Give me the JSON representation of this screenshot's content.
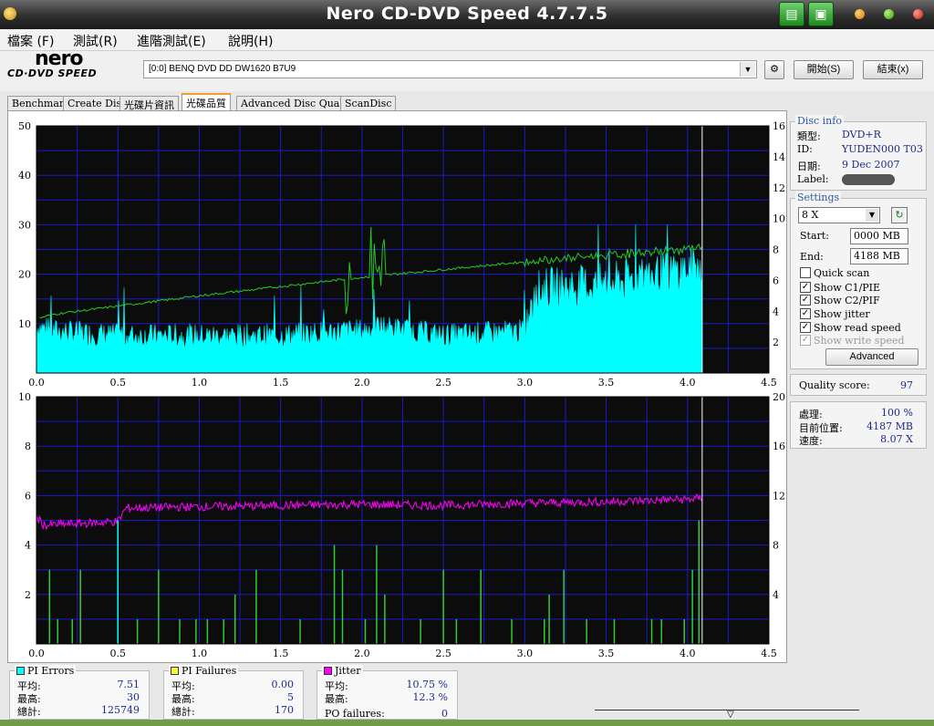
{
  "window": {
    "title": "Nero CD-DVD Speed 4.7.7.5"
  },
  "menu": [
    "檔案 (F)",
    "測試(R)",
    "進階測試(E)",
    "說明(H)"
  ],
  "logo": {
    "brand": "nero",
    "sub": "CD·DVD SPEED"
  },
  "toolbar": {
    "drive": "[0:0]   BENQ DVD DD DW1620 B7U9",
    "start_label": "開始(S)",
    "exit_label": "結束(x)"
  },
  "tabs": [
    "Benchmark",
    "Create Disc",
    "光碟片資訊",
    "光碟品質",
    "Advanced Disc Quality",
    "ScanDisc"
  ],
  "active_tab": "光碟品質",
  "disc_info": {
    "title": "Disc info",
    "type_label": "類型:",
    "type": "DVD+R",
    "id_label": "ID:",
    "id": "YUDEN000 T03",
    "date_label": "日期:",
    "date": "9 Dec 2007",
    "label_label": "Label:"
  },
  "settings": {
    "title": "Settings",
    "speed": "8 X",
    "start_label": "Start:",
    "start": "0000 MB",
    "end_label": "End:",
    "end": "4188 MB",
    "checkboxes": [
      {
        "label": "Quick scan",
        "checked": false
      },
      {
        "label": "Show C1/PIE",
        "checked": true
      },
      {
        "label": "Show C2/PIF",
        "checked": true
      },
      {
        "label": "Show jitter",
        "checked": true
      },
      {
        "label": "Show read speed",
        "checked": true
      },
      {
        "label": "Show write speed",
        "checked": true
      }
    ],
    "advanced_label": "Advanced"
  },
  "quality": {
    "label": "Quality score:",
    "value": "97"
  },
  "progress": {
    "process_label": "處理:",
    "process": "100 %",
    "position_label": "目前位置:",
    "position": "4187 MB",
    "speed_label": "速度:",
    "speed": "8.07 X"
  },
  "stats": {
    "pi_errors": {
      "title": "PI Errors",
      "avg_label": "平均:",
      "avg": "7.51",
      "max_label": "最高:",
      "max": "30",
      "total_label": "總計:",
      "total": "125749"
    },
    "pi_failures": {
      "title": "PI Failures",
      "avg_label": "平均:",
      "avg": "0.00",
      "max_label": "最高:",
      "max": "5",
      "total_label": "總計:",
      "total": "170"
    },
    "jitter": {
      "title": "Jitter",
      "avg_label": "平均:",
      "avg": "10.75 %",
      "max_label": "最高:",
      "max": "12.3 %",
      "po_label": "PO failures:",
      "po": "0"
    }
  },
  "colors": {
    "pie": "#00ffff",
    "pif": "#33cc33",
    "jitter": "#ff00ff",
    "speed": "#22cc22",
    "grid": "#1a1acc",
    "plot_bg": "#0c0c0c"
  },
  "chart_data": [
    {
      "type": "area",
      "x_ticks": [
        "0.0",
        "0.5",
        "1.0",
        "1.5",
        "2.0",
        "2.5",
        "3.0",
        "3.5",
        "4.0",
        "4.5"
      ],
      "y_ticks_left": [
        "10",
        "20",
        "30",
        "40",
        "50"
      ],
      "y_ticks_right": [
        "2",
        "4",
        "6",
        "8",
        "10",
        "12",
        "14",
        "16"
      ],
      "xlim": [
        0,
        4.5
      ],
      "ylim": [
        0,
        50
      ],
      "y2lim": [
        0,
        16
      ],
      "series": [
        {
          "values_at": [
            0,
            0.1,
            0.5,
            1.0,
            1.5,
            1.9,
            2.0,
            2.1,
            2.5,
            3.0,
            3.1,
            3.5,
            4.0,
            4.09
          ],
          "values": [
            9,
            8,
            7,
            7,
            7,
            8,
            8,
            9,
            7,
            8,
            16,
            17,
            20,
            21
          ]
        },
        {
          "values_at": [
            0,
            0.1,
            1.0,
            2.0,
            3.0,
            4.09
          ],
          "values": [
            3.5,
            3.8,
            5.0,
            6.2,
            7.2,
            8.1
          ]
        }
      ]
    },
    {
      "type": "bar",
      "x_ticks": [
        "0.0",
        "0.5",
        "1.0",
        "1.5",
        "2.0",
        "2.5",
        "3.0",
        "3.5",
        "4.0",
        "4.5"
      ],
      "y_ticks_left": [
        "2",
        "4",
        "6",
        "8",
        "10"
      ],
      "y_ticks_right": [
        "4",
        "8",
        "12",
        "16",
        "20"
      ],
      "xlim": [
        0,
        4.5
      ],
      "ylim": [
        0,
        10
      ],
      "y2lim": [
        0,
        20
      ],
      "pif_x": [
        0.08,
        0.13,
        0.22,
        0.27,
        0.5,
        0.62,
        0.75,
        0.88,
        0.98,
        1.05,
        1.15,
        1.22,
        1.35,
        1.62,
        1.83,
        1.88,
        2.02,
        2.09,
        2.14,
        2.36,
        2.5,
        2.58,
        2.73,
        2.92,
        3.12,
        3.15,
        3.24,
        3.38,
        3.55,
        3.78,
        3.84,
        3.98,
        4.03,
        4.07
      ],
      "pif_y": [
        3,
        1,
        1,
        3,
        5,
        1,
        3,
        1,
        1,
        1,
        1,
        2,
        3,
        1,
        4,
        3,
        1,
        4,
        2,
        1,
        3,
        1,
        3,
        1,
        1,
        2,
        3,
        1,
        1,
        1,
        1,
        1,
        3,
        5
      ],
      "jitter_at": [
        0,
        0.05,
        0.2,
        0.5,
        0.55,
        1.0,
        1.5,
        2.0,
        2.5,
        3.0,
        3.5,
        4.0,
        4.09
      ],
      "jitter": [
        10.2,
        9.6,
        9.7,
        9.9,
        11.0,
        11.1,
        11.2,
        11.3,
        11.2,
        11.4,
        11.5,
        11.7,
        11.8
      ]
    }
  ]
}
